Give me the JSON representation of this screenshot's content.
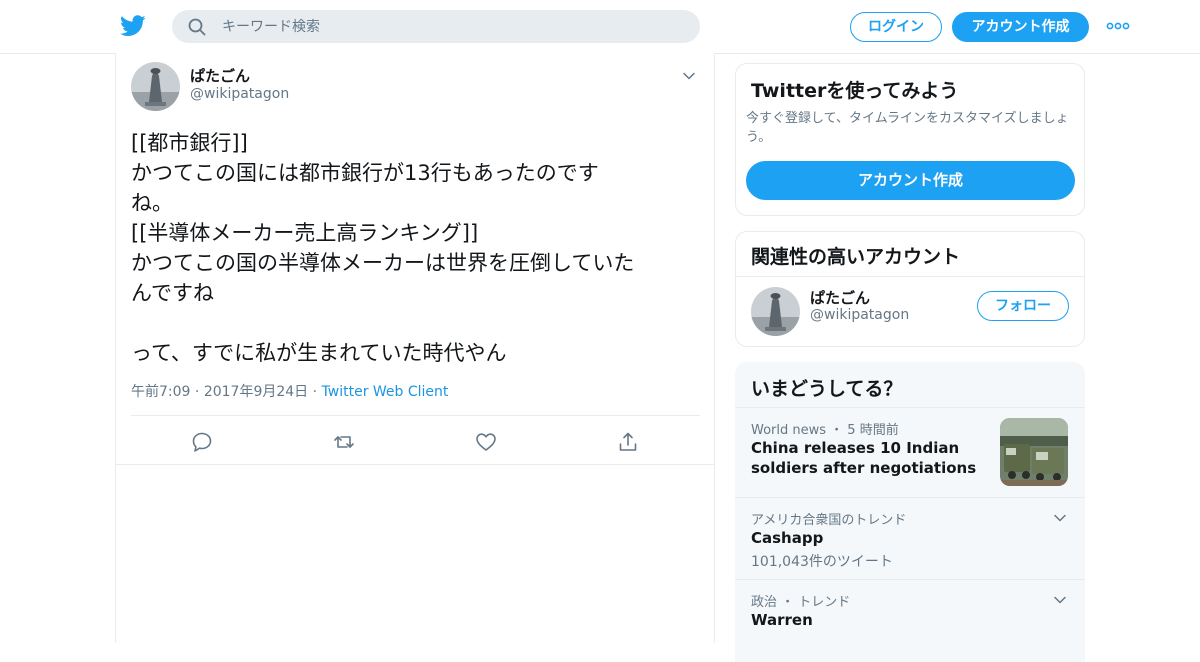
{
  "header": {
    "search_placeholder": "キーワード検索",
    "login_label": "ログイン",
    "signup_label": "アカウント作成"
  },
  "tweet": {
    "author_name": "ぱたごん",
    "author_handle": "@wikipatagon",
    "text": "[[都市銀行]]\nかつてこの国には都市銀行が13行もあったのです\nね。\n[[半導体メーカー売上高ランキング]]\nかつてこの国の半導体メーカーは世界を圧倒していた\nんですね\n\nって、すでに私が生まれていた時代やん",
    "time": "午前7:09",
    "date": "2017年9月24日",
    "client": "Twitter Web Client"
  },
  "signup_card": {
    "title": "Twitterを使ってみよう",
    "description": "今すぐ登録して、タイムラインをカスタマイズしましょう。",
    "button_label": "アカウント作成"
  },
  "related_card": {
    "title": "関連性の高いアカウント",
    "account_name": "ぱたごん",
    "account_handle": "@wikipatagon",
    "follow_label": "フォロー"
  },
  "trends_card": {
    "title": "いまどうしてる？",
    "items": [
      {
        "context": "World news ・ 5 時間前",
        "name": "China releases 10 Indian soldiers after negotiations"
      },
      {
        "context": "アメリカ合衆国のトレンド",
        "name": "Cashapp",
        "count": "101,043件のツイート"
      },
      {
        "context": "政治 ・ トレンド",
        "name": "Warren"
      }
    ]
  },
  "colors": {
    "accent": "#1da1f2",
    "text": "#14171a",
    "muted": "#657786",
    "border": "#e6ecf0",
    "panel_bg": "#f5f8fa"
  }
}
